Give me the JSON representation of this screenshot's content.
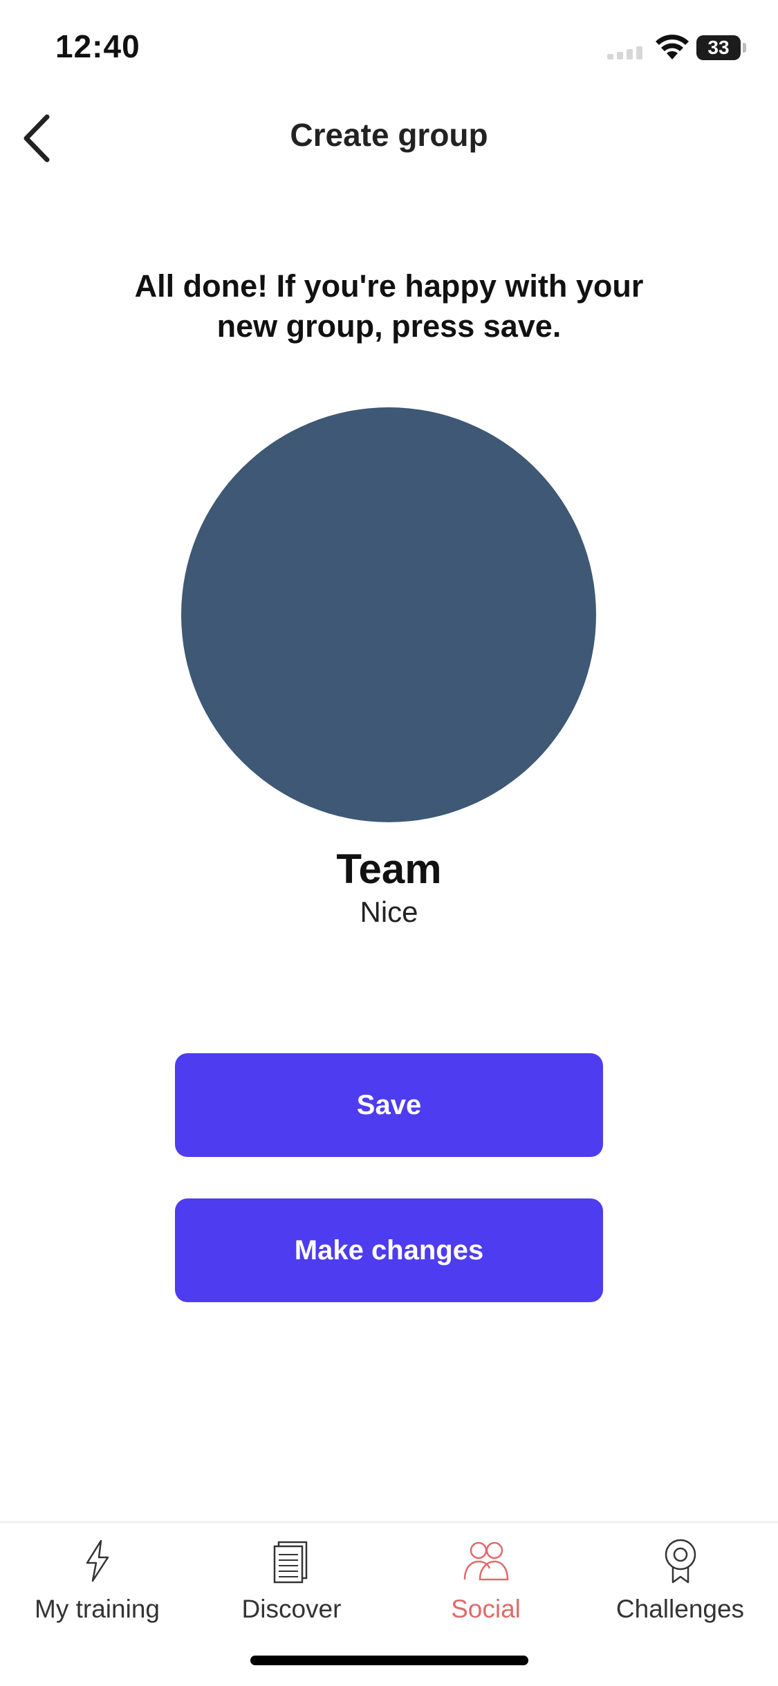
{
  "status_bar": {
    "time": "12:40",
    "battery": "33"
  },
  "header": {
    "title": "Create group"
  },
  "main": {
    "prompt": "All done! If you're happy with your new group, press save.",
    "avatar_color": "#3e5875",
    "group_name": "Team",
    "group_description": "Nice",
    "save_label": "Save",
    "make_changes_label": "Make changes",
    "button_color": "#4d3cf0"
  },
  "nav": {
    "items": [
      {
        "label": "My training",
        "icon": "lightning-icon",
        "active": false
      },
      {
        "label": "Discover",
        "icon": "newspaper-icon",
        "active": false
      },
      {
        "label": "Social",
        "icon": "people-icon",
        "active": true
      },
      {
        "label": "Challenges",
        "icon": "medal-icon",
        "active": false
      }
    ],
    "active_color": "#e06a6a"
  }
}
